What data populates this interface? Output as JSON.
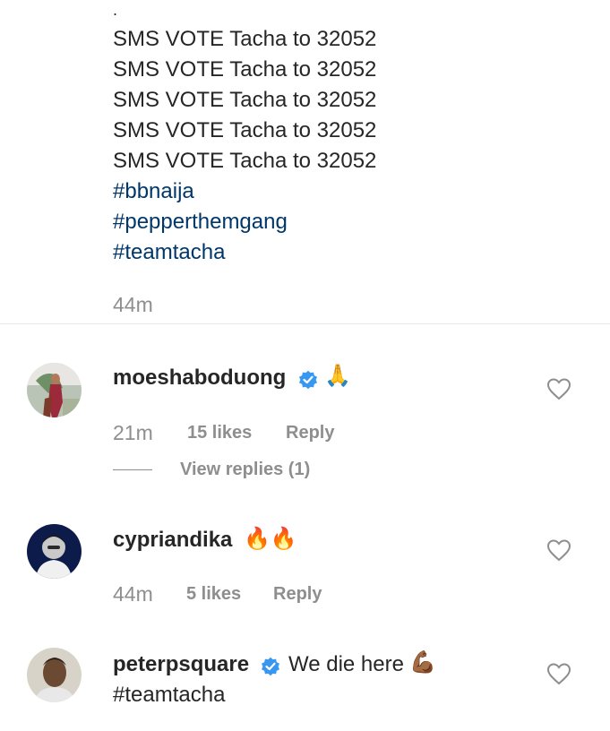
{
  "caption": {
    "dot": ".",
    "lines": [
      "SMS VOTE Tacha to 32052",
      "SMS VOTE Tacha to 32052",
      "SMS VOTE Tacha to 32052",
      "SMS VOTE Tacha to 32052",
      "SMS VOTE Tacha to 32052"
    ],
    "hashtags": [
      "#bbnaija",
      "#pepperthemgang",
      "#teamtacha"
    ],
    "time": "44m"
  },
  "comments": [
    {
      "username": "moeshaboduong",
      "verified": true,
      "emoji": "🙏",
      "time": "21m",
      "likes": "15 likes",
      "reply": "Reply",
      "view_replies": "View replies (1)"
    },
    {
      "username": "cypriandika",
      "verified": false,
      "emoji": "🔥🔥",
      "time": "44m",
      "likes": "5 likes",
      "reply": "Reply"
    },
    {
      "username": "peterpsquare",
      "verified": true,
      "text": "We die here",
      "emoji": "💪🏾",
      "hashtag": "#teamtacha"
    }
  ],
  "colors": {
    "text": "#262626",
    "hashtag": "#00376b",
    "muted": "#8e8e8e",
    "verified": "#3897f0",
    "divider": "#e6e6e6"
  },
  "icons": [
    "heart-outline-icon",
    "verified-badge-icon"
  ]
}
